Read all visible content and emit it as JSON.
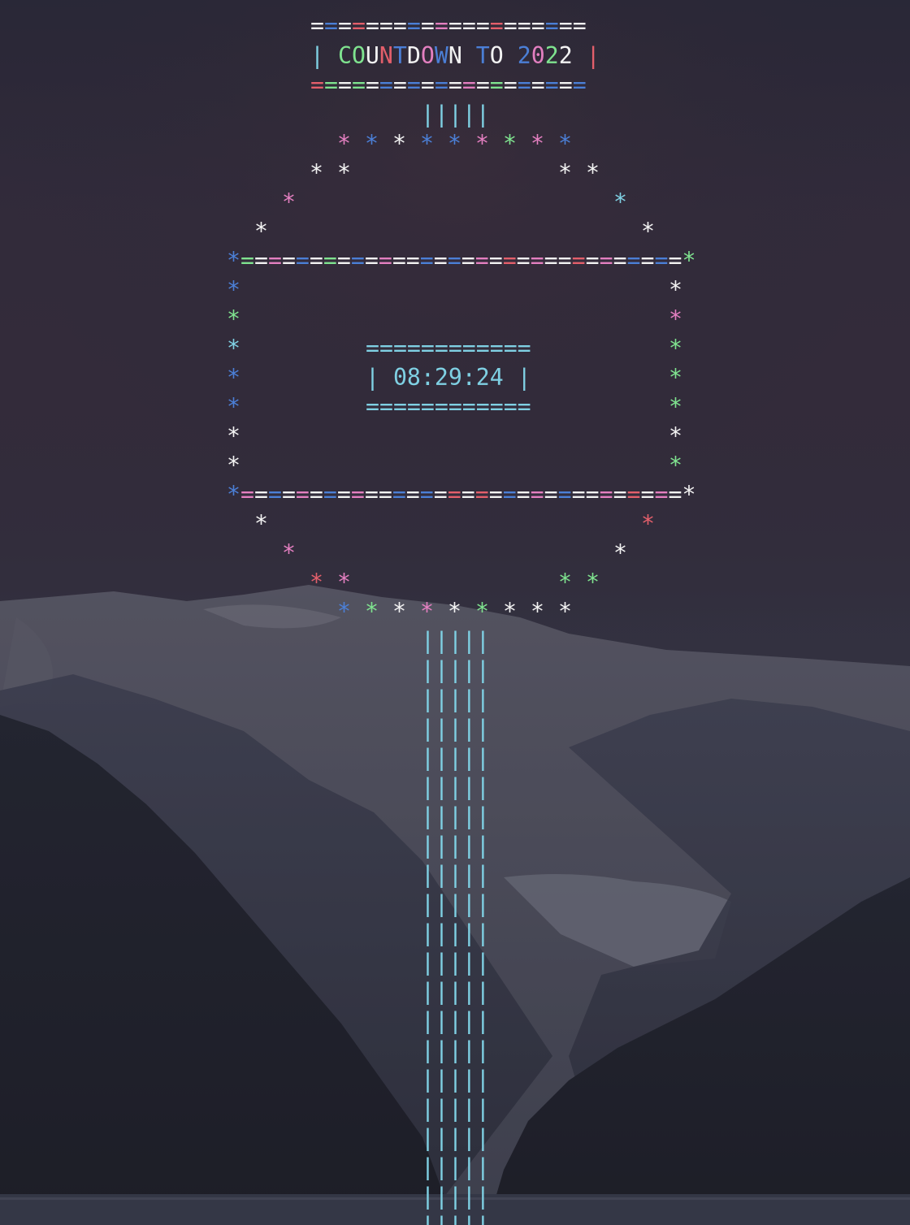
{
  "colors": {
    "white": "#f2f2f2",
    "blue": "#4b7fd6",
    "pink": "#e37fc0",
    "green": "#7fe38f",
    "red": "#e35f6b",
    "cyan": "#7fd0e3",
    "background": "#2c2b3a"
  },
  "banner": {
    "title_prefix": "| ",
    "title": "COUNTDOWN TO 2022",
    "title_suffix": " |",
    "rule": "===================="
  },
  "clock": {
    "time": "08:29:24",
    "display": "| 08:29:24 |",
    "rule": "============"
  },
  "stem_glyph": "|||||",
  "star_glyph": "*",
  "box_rule": "================================"
}
